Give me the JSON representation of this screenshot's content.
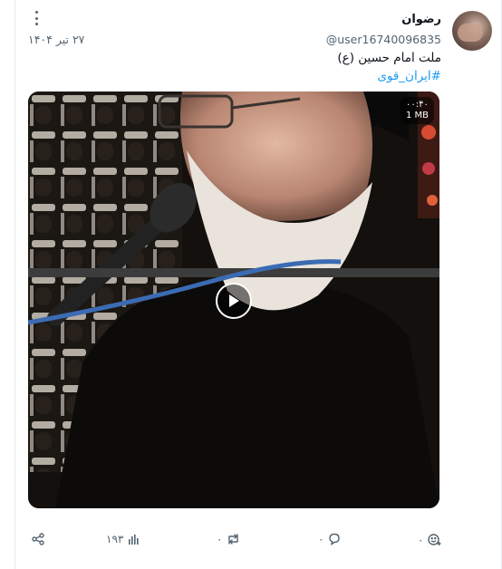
{
  "post": {
    "display_name": "رضوان",
    "handle": "@user16740096835",
    "date": "۲۷ تیر ۱۴۰۴",
    "text": "ملت امام حسین (ع)",
    "hashtag": "#ایران_قوی",
    "video": {
      "duration": "۰۰:۴۰",
      "size": "1 MB"
    }
  },
  "actions": {
    "reactions_count": "۰",
    "replies_count": "۰",
    "reposts_count": "۰",
    "views_count": "۱۹۳"
  },
  "icons": {
    "more": "more-vertical-icon",
    "play": "play-icon",
    "reaction": "add-reaction-icon",
    "reply": "reply-icon",
    "repost": "repost-icon",
    "views": "views-icon",
    "share": "share-icon"
  },
  "colors": {
    "link": "#1d9bf0",
    "muted_text": "#536471",
    "primary_text": "#0f1419"
  }
}
